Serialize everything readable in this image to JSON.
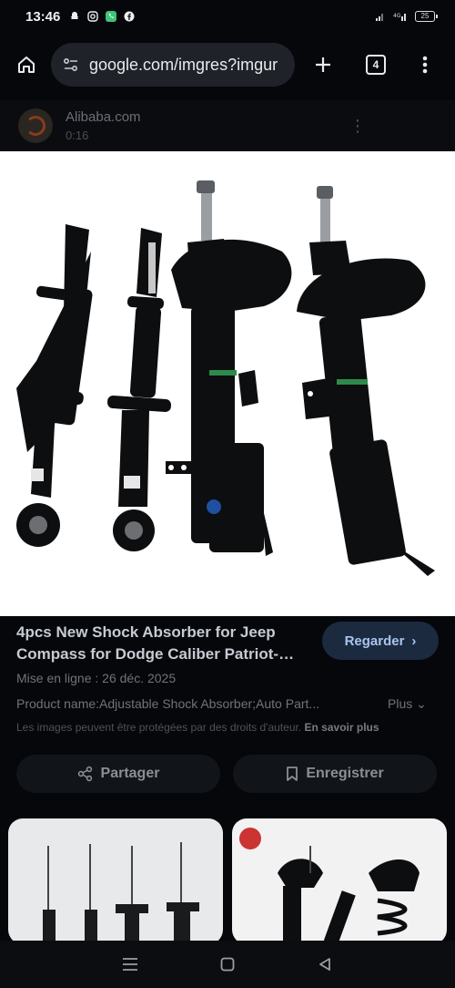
{
  "status": {
    "time": "13:46",
    "battery": "25",
    "left_icons": [
      "snapchat-icon",
      "instagram-icon",
      "phone-icon",
      "facebook-icon"
    ],
    "right_icons": [
      "signal-icon",
      "data-4g-icon",
      "wifi-icon",
      "battery-icon"
    ]
  },
  "browser": {
    "url": "google.com/imgres?imgur",
    "tab_count": "4"
  },
  "source": {
    "name": "Alibaba.com",
    "duration": "0:16"
  },
  "result": {
    "title": "4pcs New Shock Absorber for Jeep Compass for Dodge Caliber Patriot-…",
    "view_button": "Regarder",
    "posted": "Mise en ligne : 26 déc. 2025",
    "product_name": "Product name:Adjustable Shock Absorber;Auto Part...",
    "more": "Plus",
    "copyright": "Les images peuvent être protégées par des droits d'auteur.",
    "learn_more": "En savoir plus",
    "share_button": "Partager",
    "save_button": "Enregistrer"
  },
  "colors": {
    "background": "#05070a",
    "accent_button": "#1c2a3f",
    "accent_text": "#a8c4ef"
  }
}
